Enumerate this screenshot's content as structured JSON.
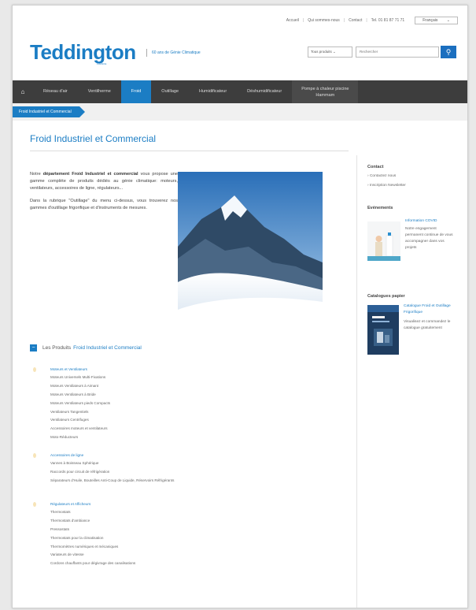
{
  "topbar": {
    "links": [
      "Accueil",
      "Qui sommes-nous",
      "Contact",
      "Tel. 01 81 87 71 71"
    ],
    "language": "Français"
  },
  "header": {
    "logo": "Teddington",
    "logo_sub": "FRANCE",
    "tagline": "60 ans de Génie Climatique",
    "search_select": "Tous produits",
    "search_placeholder": "Rechercher"
  },
  "nav": {
    "items": [
      "Réseau d'air",
      "Ventilherme",
      "Froid",
      "Outillage",
      "Humidificateur",
      "Déshumidificateur"
    ],
    "last_line1": "Pompe à chaleur piscine",
    "last_line2": "Hammam",
    "active": "Froid"
  },
  "breadcrumb": "Froid Industriel et Commercial",
  "page_title": "Froid Industriel et Commercial",
  "intro": {
    "p1_a": "Notre ",
    "p1_b": "département Froid Industriel et commercial",
    "p1_c": " vous propose une gamme complète de produits dédiés au génie climatique: moteurs, ventilateurs, accessoires de ligne, régulateurs...",
    "p2": "Dans la rubrique \"Outillage\" du menu ci-dessus, vous trouverez nos gammes d'outillage frigorifique et d'instruments de mesures."
  },
  "products": {
    "heading_a": "Les Produits",
    "heading_b": "Froid Industriel et Commercial",
    "groups": [
      {
        "title": "Moteurs et Ventilateurs",
        "items": [
          "Moteurs Universels Multi-Fixations",
          "Moteurs Ventilateurs à Aimant",
          "Moteurs Ventilateurs à Bride",
          "Moteurs Ventilateurs pieds Compacts",
          "Ventilateurs Tangentiels",
          "Ventilateurs Centrifuges",
          "Accessoires moteurs et ventilateurs",
          "Moto-Réducteurs"
        ]
      },
      {
        "title": "Accessoires de ligne",
        "items": [
          "Vannes à Boisseau Sphérique",
          "Raccords pour circuit de réfrigération",
          "Séparateurs d'Huile, Bouteilles Anti-Coup de Liquide, Réservoirs Réfrigérants"
        ]
      },
      {
        "title": "Régulateurs et Afficheurs",
        "items": [
          "Thermostats",
          "Thermostats d'ambiance",
          "Pressostats",
          "Thermostats pour la climatisation",
          "Thermomètres numériques et mécaniques",
          "Variateurs de vitesse",
          "Cordons chauffants pour dégivrage des canalisations"
        ]
      }
    ]
  },
  "sidebar": {
    "contact_title": "Contact",
    "contact_links": [
      "Contactez nous",
      "Inscription Newsletter"
    ],
    "events_title": "Evénements",
    "event_title": "Information COVID",
    "event_text": "Notre engagement permanent continue de vous accompagner dans vos projets",
    "catalog_title": "Catalogues papier",
    "catalog_link": "Catalogue Froid et Outillage Frigorifique",
    "catalog_text": "Visualisez et commandez le catalogue gratuitement"
  }
}
